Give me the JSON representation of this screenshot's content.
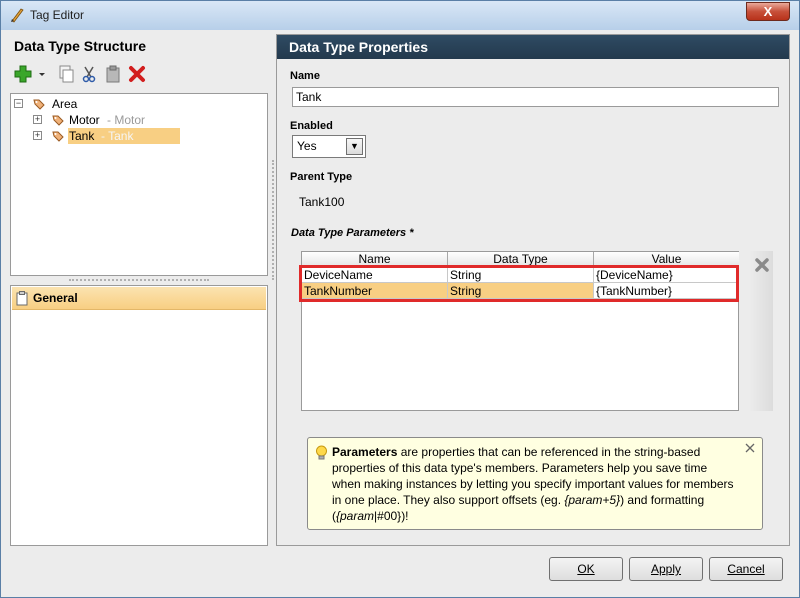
{
  "window": {
    "title": "Tag Editor",
    "close_glyph": "X"
  },
  "left": {
    "header": "Data Type Structure",
    "toolbar_icons": [
      "add-icon",
      "dropdown-arrow-icon",
      "copy-icon",
      "cut-icon",
      "paste-icon",
      "delete-icon"
    ],
    "tree": {
      "root": {
        "label": "Area"
      },
      "children": [
        {
          "label": "Motor",
          "suffix": "- Motor"
        },
        {
          "label": "Tank",
          "suffix": "- Tank"
        }
      ]
    },
    "categories": [
      {
        "label": "General"
      }
    ]
  },
  "right": {
    "header": "Data Type Properties",
    "name_label": "Name",
    "name_value": "Tank",
    "enabled_label": "Enabled",
    "enabled_value": "Yes",
    "parent_label": "Parent Type",
    "parent_value": "Tank100",
    "params_label": "Data Type Parameters *",
    "table": {
      "columns": [
        "Name",
        "Data Type",
        "Value"
      ],
      "rows": [
        {
          "name": "DeviceName",
          "type": "String",
          "value": "{DeviceName}"
        },
        {
          "name": "TankNumber",
          "type": "String",
          "value": "{TankNumber}"
        }
      ]
    },
    "info": {
      "bold_lead": "Parameters",
      "text_1": " are properties that can be referenced in the string-based properties of this data type's members. Parameters help you save time when making instances by letting you specify important values for members in one place. They also support offsets (eg. ",
      "example_1": "{param+5}",
      "text_2": ") and formatting (",
      "example_2a": "{param",
      "example_2b": "|#00}",
      "text_3": ")!"
    }
  },
  "buttons": {
    "ok": "OK",
    "apply": "Apply",
    "cancel": "Cancel"
  },
  "colors": {
    "header_dark": "#23394d",
    "selection": "#f8cf83",
    "highlight_red": "#e02a2a",
    "info_bg": "#ffffe1"
  }
}
